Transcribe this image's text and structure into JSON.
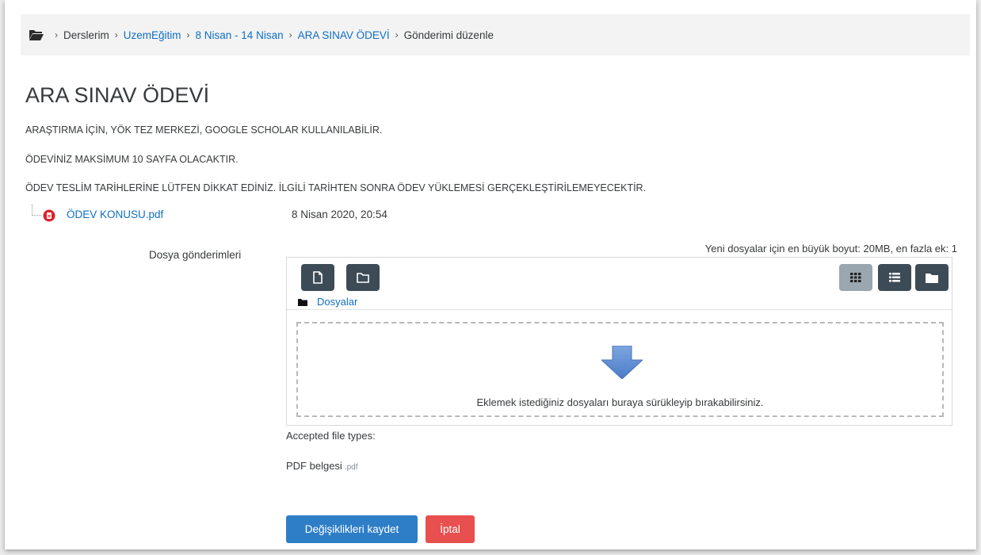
{
  "breadcrumb": {
    "icon": "folder-open-icon",
    "items": [
      "Derslerim",
      "UzemEğitim",
      "8 Nisan - 14 Nisan",
      "ARA SINAV ÖDEVİ",
      "Gönderimi düzenle"
    ],
    "separator": "›"
  },
  "page": {
    "title": "ARA SINAV ÖDEVİ",
    "descriptions": [
      "ARAŞTIRMA İÇİN, YÖK TEZ MERKEZİ, GOOGLE SCHOLAR KULLANILABİLİR.",
      "ÖDEVİNİZ MAKSİMUM 10 SAYFA OLACAKTIR.",
      "ÖDEV TESLİM TARİHLERİNE LÜTFEN DİKKAT EDİNİZ. İLGİLİ TARİHTEN SONRA ÖDEV YÜKLEMESİ GERÇEKLEŞTİRİLEMEYECEKTİR."
    ]
  },
  "attachment": {
    "name": "ÖDEV KONUSU.pdf",
    "date": "8 Nisan 2020, 20:54",
    "icon": "pdf-file-icon"
  },
  "submission": {
    "label": "Dosya gönderimleri",
    "max_info": "Yeni dosyalar için en büyük boyut: 20MB, en fazla ek: 1",
    "path_label": "Dosyalar",
    "drop_text": "Eklemek istediğiniz dosyaları buraya sürükleyip bırakabilirsiniz.",
    "accepted_label": "Accepted file types:",
    "file_type": "PDF belgesi",
    "file_ext": ".pdf"
  },
  "buttons": {
    "save": "Değişiklikleri kaydet",
    "cancel": "İptal"
  },
  "colors": {
    "link": "#0f6fc5",
    "primary": "#2d7ec7",
    "danger": "#e7504f",
    "toolbar_button": "#3d4b56"
  }
}
